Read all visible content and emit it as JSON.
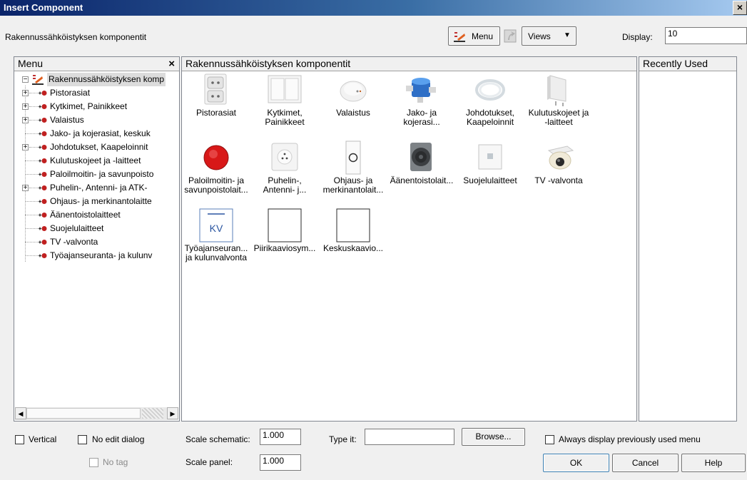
{
  "window": {
    "title": "Insert Component",
    "close_glyph": "×"
  },
  "toolbar": {
    "heading": "Rakennussähköistyksen komponentit",
    "menu_label": "Menu",
    "views_label": "Views",
    "dropdown_glyph": "▼",
    "display_label": "Display:",
    "display_value": "10"
  },
  "menu_panel": {
    "title": "Menu",
    "close_glyph": "×",
    "root": "Rakennussähköistyksen komp",
    "items": [
      {
        "label": "Pistorasiat",
        "expandable": true
      },
      {
        "label": "Kytkimet, Painikkeet",
        "expandable": true
      },
      {
        "label": "Valaistus",
        "expandable": true
      },
      {
        "label": "Jako- ja kojerasiat, keskuk",
        "expandable": false
      },
      {
        "label": "Johdotukset, Kaapeloinnit",
        "expandable": true
      },
      {
        "label": "Kulutuskojeet ja -laitteet",
        "expandable": false
      },
      {
        "label": "Paloilmoitin- ja savunpoisto",
        "expandable": false
      },
      {
        "label": "Puhelin-, Antenni- ja ATK-",
        "expandable": true
      },
      {
        "label": "Ohjaus- ja merkinantolaitte",
        "expandable": false
      },
      {
        "label": "Äänentoistolaitteet",
        "expandable": false
      },
      {
        "label": "Suojelulaitteet",
        "expandable": false
      },
      {
        "label": "TV -valvonta",
        "expandable": false
      },
      {
        "label": "Työajanseuranta- ja kulunv",
        "expandable": false
      }
    ]
  },
  "components_panel": {
    "title": "Rakennussähköistyksen komponentit",
    "items": [
      {
        "icon": "socket-icon",
        "l1": "Pistorasiat",
        "l2": ""
      },
      {
        "icon": "switch-icon",
        "l1": "Kytkimet,",
        "l2": "Painikkeet"
      },
      {
        "icon": "smoke-detector-icon",
        "l1": "Valaistus",
        "l2": ""
      },
      {
        "icon": "junction-box-icon",
        "l1": "Jako- ja",
        "l2": "kojerasi..."
      },
      {
        "icon": "cable-coil-icon",
        "l1": "Johdotukset,",
        "l2": "Kaapeloinnit"
      },
      {
        "icon": "heater-icon",
        "l1": "Kulutuskojeet ja",
        "l2": "-laitteet"
      },
      {
        "icon": "alarm-bell-icon",
        "l1": "Paloilmoitin- ja",
        "l2": "savunpoistolait..."
      },
      {
        "icon": "antenna-socket-icon",
        "l1": "Puhelin-,",
        "l2": "Antenni- j..."
      },
      {
        "icon": "push-button-icon",
        "l1": "Ohjaus- ja",
        "l2": "merkinantolait..."
      },
      {
        "icon": "speaker-icon",
        "l1": "Äänentoistolait...",
        "l2": ""
      },
      {
        "icon": "protection-device-icon",
        "l1": "Suojelulaitteet",
        "l2": ""
      },
      {
        "icon": "cctv-camera-icon",
        "l1": "TV -valvonta",
        "l2": ""
      },
      {
        "icon": "kv-symbol-icon",
        "l1": "Työajanseuran...",
        "l2": "ja kulunvalvonta",
        "symbol": "KV"
      },
      {
        "icon": "blank-icon",
        "l1": "Piirikaaviosym...",
        "l2": ""
      },
      {
        "icon": "blank-icon",
        "l1": "Keskuskaavio...",
        "l2": ""
      }
    ]
  },
  "recent_panel": {
    "title": "Recently Used"
  },
  "bottom": {
    "vertical": "Vertical",
    "no_edit_dialog": "No edit dialog",
    "no_tag": "No tag",
    "scale_schematic_label": "Scale schematic:",
    "scale_schematic_value": "1.000",
    "scale_panel_label": "Scale panel:",
    "scale_panel_value": "1.000",
    "type_it_label": "Type it:",
    "type_it_value": "",
    "browse": "Browse...",
    "always_display": "Always display previously used menu",
    "ok": "OK",
    "cancel": "Cancel",
    "help": "Help"
  }
}
